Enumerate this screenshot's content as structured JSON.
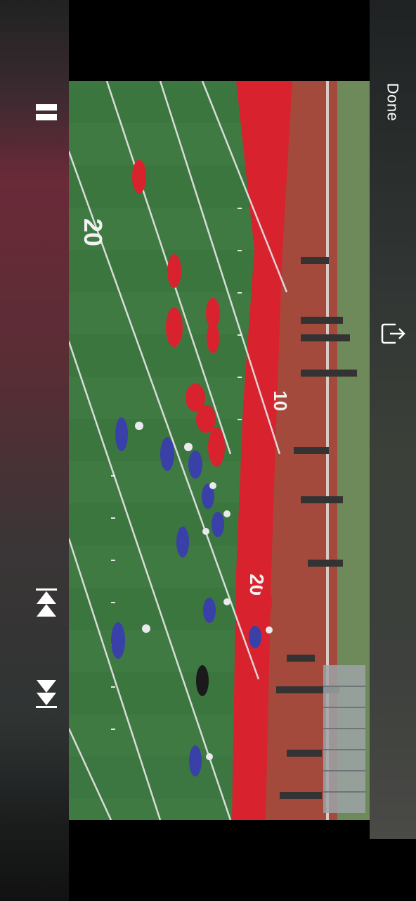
{
  "controls": {
    "done_label": "Done",
    "pause_icon": "pause-icon",
    "previous_icon": "skip-previous-icon",
    "next_icon": "skip-next-icon",
    "share_icon": "share-icon"
  },
  "video": {
    "field_numbers": [
      "20",
      "10",
      "20"
    ]
  },
  "colors": {
    "field_green": "#3f7a42",
    "end_zone_red": "#d8232e",
    "track_red": "#a44a3c",
    "home_team": "#d8232e",
    "away_team": "#3940a8"
  }
}
